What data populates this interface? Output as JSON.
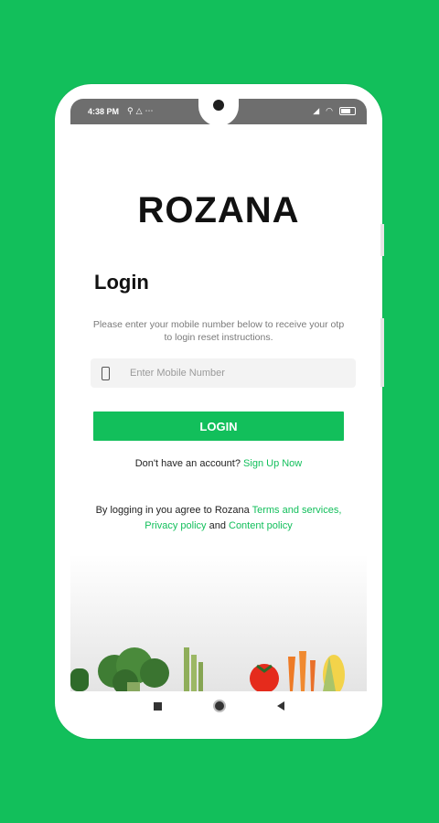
{
  "status_bar": {
    "time": "4:38 PM",
    "left_icons": [
      "usb-icon",
      "warning-icon",
      "more-icon"
    ],
    "right_icons": [
      "signal-icon",
      "wifi-icon",
      "battery-icon"
    ]
  },
  "app": {
    "brand": "ROZANA",
    "heading": "Login",
    "instructions": "Please enter your mobile number below to receive your otp to login reset instructions.",
    "mobile_placeholder": "Enter Mobile Number",
    "login_button": "LOGIN",
    "signup_prompt": "Don't have an account?",
    "signup_link": "Sign Up Now",
    "terms_prefix": "By logging in you agree to Rozana",
    "terms_link": "Terms and services,",
    "privacy_link": "Privacy policy",
    "and_text": "and",
    "content_link": "Content policy"
  },
  "colors": {
    "background": "#12bf5b",
    "accent": "#12bf5b"
  }
}
